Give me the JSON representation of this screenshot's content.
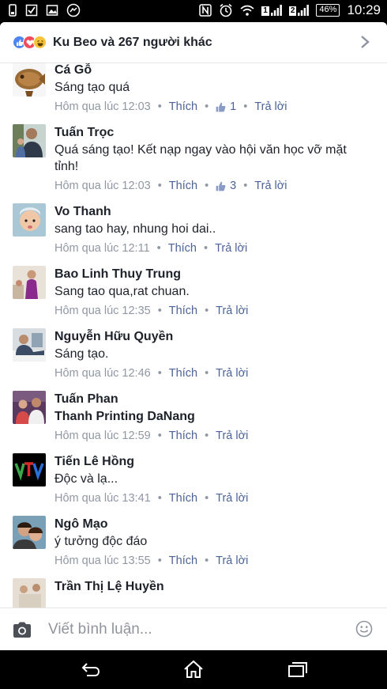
{
  "status_bar": {
    "time": "10:29",
    "battery": "46%",
    "sim1": "1",
    "sim2": "2"
  },
  "header": {
    "title": "Ku Beo và 267 người khác",
    "reactions": [
      "like-icon",
      "love-icon",
      "haha-icon"
    ]
  },
  "comments": [
    {
      "name": "Cá Gỗ",
      "text": "Sáng tạo quá",
      "time": "Hôm qua lúc 12:03",
      "like_label": "Thích",
      "likes": "1",
      "reply_label": "Trả lời"
    },
    {
      "name": "Tuấn Trọc",
      "text": "Quá sáng tạo! Kết nạp ngay vào hội văn học vỡ mặt tỉnh!",
      "time": "Hôm qua lúc 12:03",
      "like_label": "Thích",
      "likes": "3",
      "reply_label": "Trả lời"
    },
    {
      "name": "Vo Thanh",
      "text": "sang tao hay, nhung hoi dai..",
      "time": "Hôm qua lúc 12:11",
      "like_label": "Thích",
      "reply_label": "Trả lời"
    },
    {
      "name": "Bao Linh Thuy Trung",
      "text": "Sang tao qua,rat chuan.",
      "time": "Hôm qua lúc 12:35",
      "like_label": "Thích",
      "reply_label": "Trả lời"
    },
    {
      "name": "Nguyễn Hữu Quyền",
      "text": "Sáng tạo.",
      "time": "Hôm qua lúc 12:46",
      "like_label": "Thích",
      "reply_label": "Trả lời"
    },
    {
      "name": "Tuấn Phan",
      "text": "Thanh Printing DaNang",
      "time": "Hôm qua lúc 12:59",
      "like_label": "Thích",
      "reply_label": "Trả lời"
    },
    {
      "name": "Tiến Lê Hồng",
      "text": "Độc và lạ...",
      "time": "Hôm qua lúc 13:41",
      "like_label": "Thích",
      "reply_label": "Trả lời"
    },
    {
      "name": "Ngô Mạo",
      "text": "ý tưởng độc đáo",
      "time": "Hôm qua lúc 13:55",
      "like_label": "Thích",
      "reply_label": "Trả lời"
    },
    {
      "name": "Trần Thị Lệ Huyền"
    }
  ],
  "composer": {
    "placeholder": "Viết bình luận..."
  },
  "colors": {
    "link": "#4b6398",
    "meta": "#9197a3",
    "text": "#1d2129"
  }
}
